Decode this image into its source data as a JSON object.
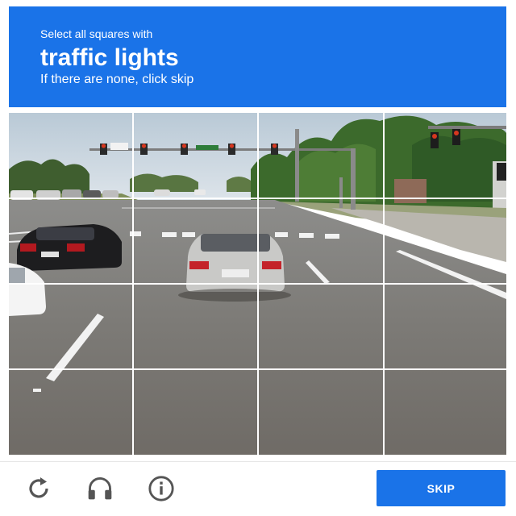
{
  "header": {
    "instruction": "Select all squares with",
    "target": "traffic lights",
    "note": "If there are none, click skip",
    "background_color": "#1a73e8"
  },
  "grid": {
    "rows": 4,
    "columns": 4,
    "image_description": "street intersection with traffic lights and cars"
  },
  "footer": {
    "icons": [
      "reload-icon",
      "audio-challenge-icon",
      "info-icon"
    ],
    "skip_label": "SKIP",
    "skip_color": "#1a73e8"
  }
}
